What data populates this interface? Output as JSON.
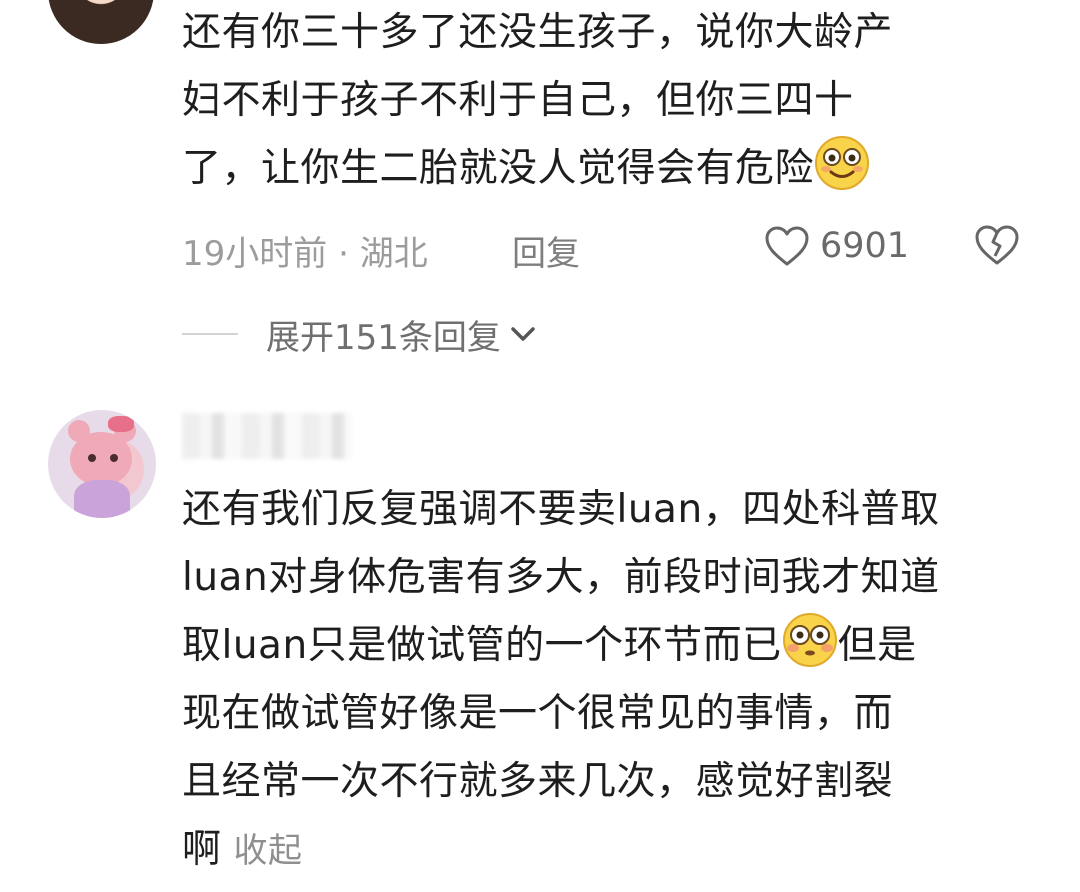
{
  "comment1": {
    "lines": [
      "还有你三十多了还没生孩子，说你大龄产",
      "妇不利于孩子不利于自己，但你三四十",
      "了，让你生二胎就没人觉得会有危险"
    ],
    "emoji": "flushed-smile-emoji",
    "time": "19小时前",
    "location": "湖北",
    "separator": "·",
    "reply_label": "回复",
    "like_count": "6901",
    "expand_label": "展开151条回复"
  },
  "comment2": {
    "lines": [
      "还有我们反复强调不要卖luan，四处科普取",
      "luan对身体危害有多大，前段时间我才知道",
      "取luan只是做试管的一个环节而已",
      "现在做试管好像是一个很常见的事情，而",
      "且经常一次不行就多来几次，感觉好割裂",
      "啊"
    ],
    "line3_suffix": "但是",
    "emoji": "flushed-emoji",
    "collapse_label": "收起"
  },
  "colors": {
    "text": "#1e1e1e",
    "meta": "#9c9c9c",
    "background": "#ffffff"
  }
}
